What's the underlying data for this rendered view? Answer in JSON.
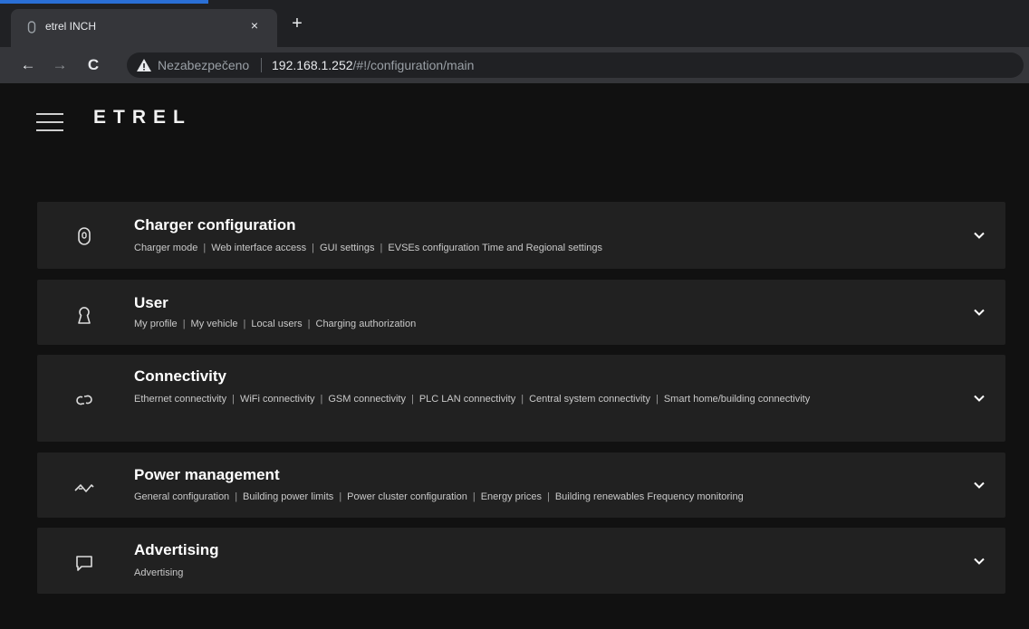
{
  "browser": {
    "tab_title": "etrel INCH",
    "close_glyph": "×",
    "new_tab_glyph": "+",
    "back_glyph": "←",
    "forward_glyph": "→",
    "reload_glyph": "C",
    "insecure_label": "Nezabezpečeno",
    "url_host": "192.168.1.252",
    "url_path": "/#!/configuration/main"
  },
  "app": {
    "logo_text": "ETREL"
  },
  "sections": [
    {
      "title": "Charger configuration",
      "icon": "plug-icon",
      "links": [
        "Charger mode",
        "Web interface access",
        "GUI settings",
        "EVSEs configuration Time and Regional settings"
      ]
    },
    {
      "title": "User",
      "icon": "user-icon",
      "links": [
        "My profile",
        "My vehicle",
        "Local users",
        "Charging authorization"
      ]
    },
    {
      "title": "Connectivity",
      "icon": "link-icon",
      "links": [
        "Ethernet connectivity",
        "WiFi connectivity",
        "GSM connectivity",
        "PLC LAN connectivity",
        "Central system connectivity",
        "Smart home/building connectivity"
      ]
    },
    {
      "title": "Power management",
      "icon": "power-wave-icon",
      "links": [
        "General configuration",
        "Building power limits",
        "Power cluster configuration",
        "Energy prices",
        "Building renewables Frequency monitoring"
      ]
    },
    {
      "title": "Advertising",
      "icon": "chat-bubble-icon",
      "links": [
        "Advertising"
      ]
    }
  ],
  "colors": {
    "page_bg": "#111111",
    "panel_bg": "#212121",
    "chrome_bg": "#202124",
    "toolbar_bg": "#35363a",
    "warning": "#e8eaed"
  }
}
